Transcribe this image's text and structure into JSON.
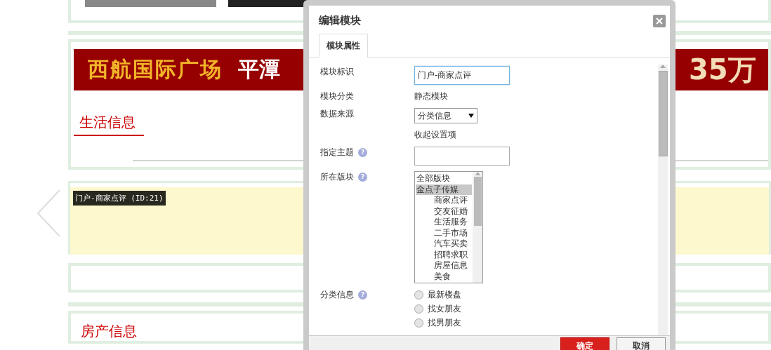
{
  "page": {
    "banner": {
      "texts": [
        "西航国际广场",
        "平潭",
        "35万"
      ]
    },
    "sections": [
      {
        "kind": "titled",
        "title": "生活信息"
      },
      {
        "kind": "module",
        "label": "门户-商家点评 (ID:21)"
      },
      {
        "kind": "empty"
      },
      {
        "kind": "titled",
        "title": "房产信息"
      }
    ]
  },
  "dialog": {
    "title": "编辑模块",
    "tabs": [
      {
        "label": "模块属性",
        "selected": true
      }
    ],
    "fields": [
      {
        "kind": "input",
        "label": "模块标识",
        "value": "门户-商家点评",
        "focused": true
      },
      {
        "kind": "text",
        "label": "模块分类",
        "value": "静态模块"
      },
      {
        "kind": "select",
        "label": "数据来源",
        "value": "分类信息"
      },
      {
        "kind": "link",
        "value": "收起设置项"
      },
      {
        "kind": "input",
        "label": "指定主题",
        "help": "?",
        "focused": false
      },
      {
        "kind": "listbox",
        "label": "所在版块",
        "help": "?",
        "options": [
          {
            "label": "全部版块",
            "selected": false
          },
          {
            "label": "金点子传媒",
            "selected": true,
            "children": [
              {
                "label": "商家点评",
                "selected": false
              },
              {
                "label": "交友征婚",
                "selected": false
              },
              {
                "label": "生活服务",
                "selected": false
              },
              {
                "label": "二手市场",
                "selected": false
              },
              {
                "label": "汽车买卖",
                "selected": false
              },
              {
                "label": "招聘求职",
                "selected": false
              },
              {
                "label": "房屋信息",
                "selected": false
              },
              {
                "label": "美食",
                "selected": false
              }
            ]
          }
        ]
      },
      {
        "kind": "radio",
        "label": "分类信息",
        "help": "?",
        "options": [
          {
            "label": "最新楼盘",
            "selected": false
          },
          {
            "label": "找女朋友",
            "selected": false
          },
          {
            "label": "找男朋友",
            "selected": false
          }
        ]
      }
    ],
    "buttons": [
      {
        "label": "确定",
        "kind": "primary"
      },
      {
        "label": "取消",
        "kind": "secondary"
      }
    ]
  }
}
